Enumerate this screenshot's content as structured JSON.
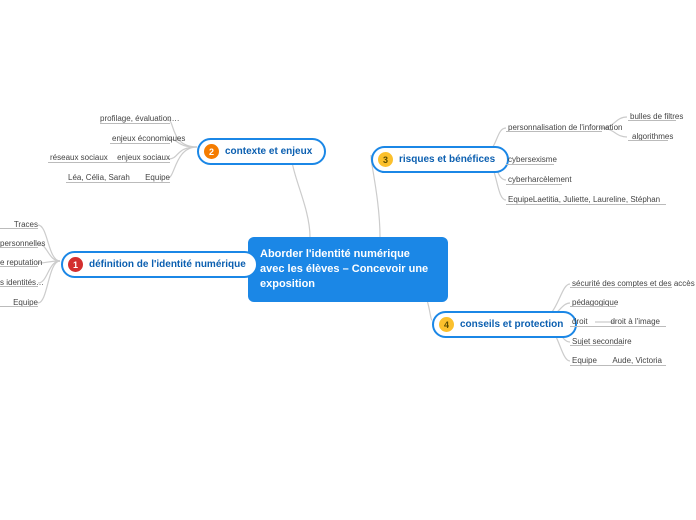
{
  "center": {
    "title": "Aborder l'identité numérique avec les élèves – Concevoir une exposition"
  },
  "branches": {
    "b1": {
      "num": "1",
      "label": "définition de l'identité numérique"
    },
    "b2": {
      "num": "2",
      "label": "contexte et enjeux"
    },
    "b3": {
      "num": "3",
      "label": "risques et bénéfices"
    },
    "b4": {
      "num": "4",
      "label": "conseils et protection"
    }
  },
  "b1_leaves": {
    "l1": "Traces",
    "l2": "personnelles",
    "l3": "e reputation",
    "l4": "s identités…",
    "l5": "Equipe"
  },
  "b2_leaves": {
    "l1": "profilage, évaluation…",
    "l2": "enjeux économiques",
    "l3a": "réseaux sociaux",
    "l3b": "enjeux sociaux",
    "l4a": "Léa, Célia, Sarah",
    "l4b": "Equipe"
  },
  "b3_leaves": {
    "l1": "personnalisation de l'information",
    "l1a": "bulles de filtres",
    "l1b": "algorithmes",
    "l2": "cybersexisme",
    "l3": "cyberharcèlement",
    "l4a": "Equipe",
    "l4b": "Laetitia, Juliette, Laureline, Stéphan"
  },
  "b4_leaves": {
    "l1": "sécurité des comptes et des accès",
    "l2": "pédagogique",
    "l3a": "droit",
    "l3b": "droit à l'image",
    "l4": "Sujet secondaire",
    "l5a": "Equipe",
    "l5b": "Aude, Victoria"
  }
}
